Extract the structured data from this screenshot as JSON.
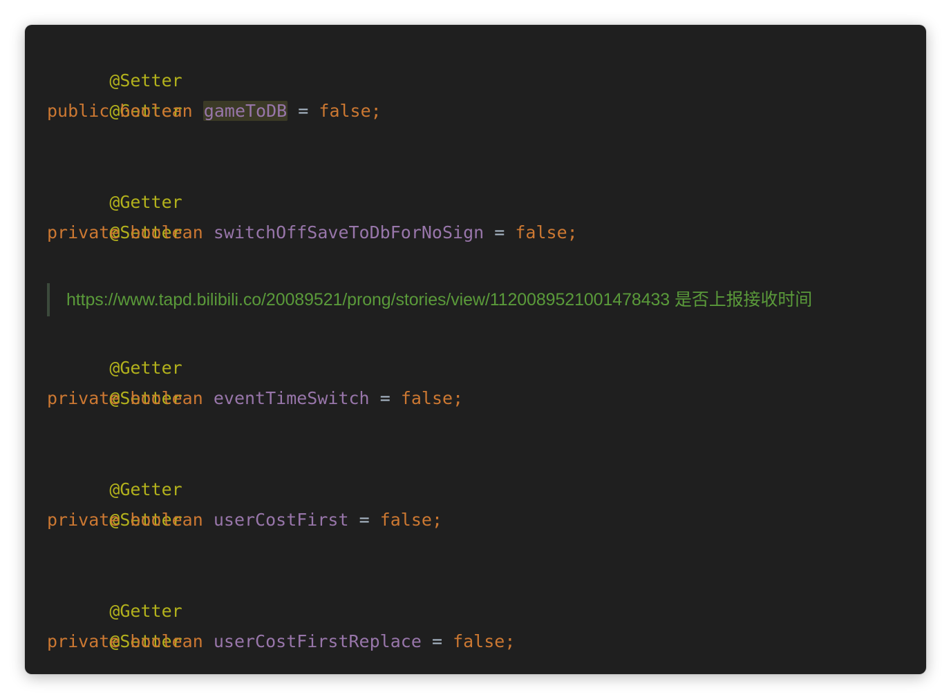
{
  "code": {
    "block1": {
      "annotation1": "@Setter",
      "annotation2": "@Getter",
      "modifier": "public",
      "type": "boolean",
      "field": "gameToDB",
      "equals": "=",
      "value": "false;"
    },
    "block2": {
      "annotation1": "@Getter",
      "annotation2": "@Setter",
      "modifier": "private",
      "type": "boolean",
      "field": "switchOffSaveToDbForNoSign",
      "equals": "=",
      "value": "false;"
    },
    "doc_comment": "https://www.tapd.bilibili.co/20089521/prong/stories/view/1120089521001478433 是否上报接收时间",
    "block3": {
      "annotation1": "@Getter",
      "annotation2": "@Setter",
      "modifier": "private",
      "type": "boolean",
      "field": "eventTimeSwitch",
      "equals": "=",
      "value": "false;"
    },
    "block4": {
      "annotation1": "@Getter",
      "annotation2": "@Setter",
      "modifier": "private",
      "type": "boolean",
      "field": "userCostFirst",
      "equals": "=",
      "value": "false;"
    },
    "block5": {
      "annotation1": "@Getter",
      "annotation2": "@Setter",
      "modifier": "private",
      "type": "boolean",
      "field": "userCostFirstReplace",
      "equals": "=",
      "value": "false;"
    }
  },
  "colors": {
    "background": "#1f1f1f",
    "annotation": "#b3b21c",
    "keyword": "#cc7832",
    "field": "#9876aa",
    "operator": "#a9b7c6",
    "doc_comment": "#5a9a3a",
    "highlight": "#3b3a26"
  }
}
